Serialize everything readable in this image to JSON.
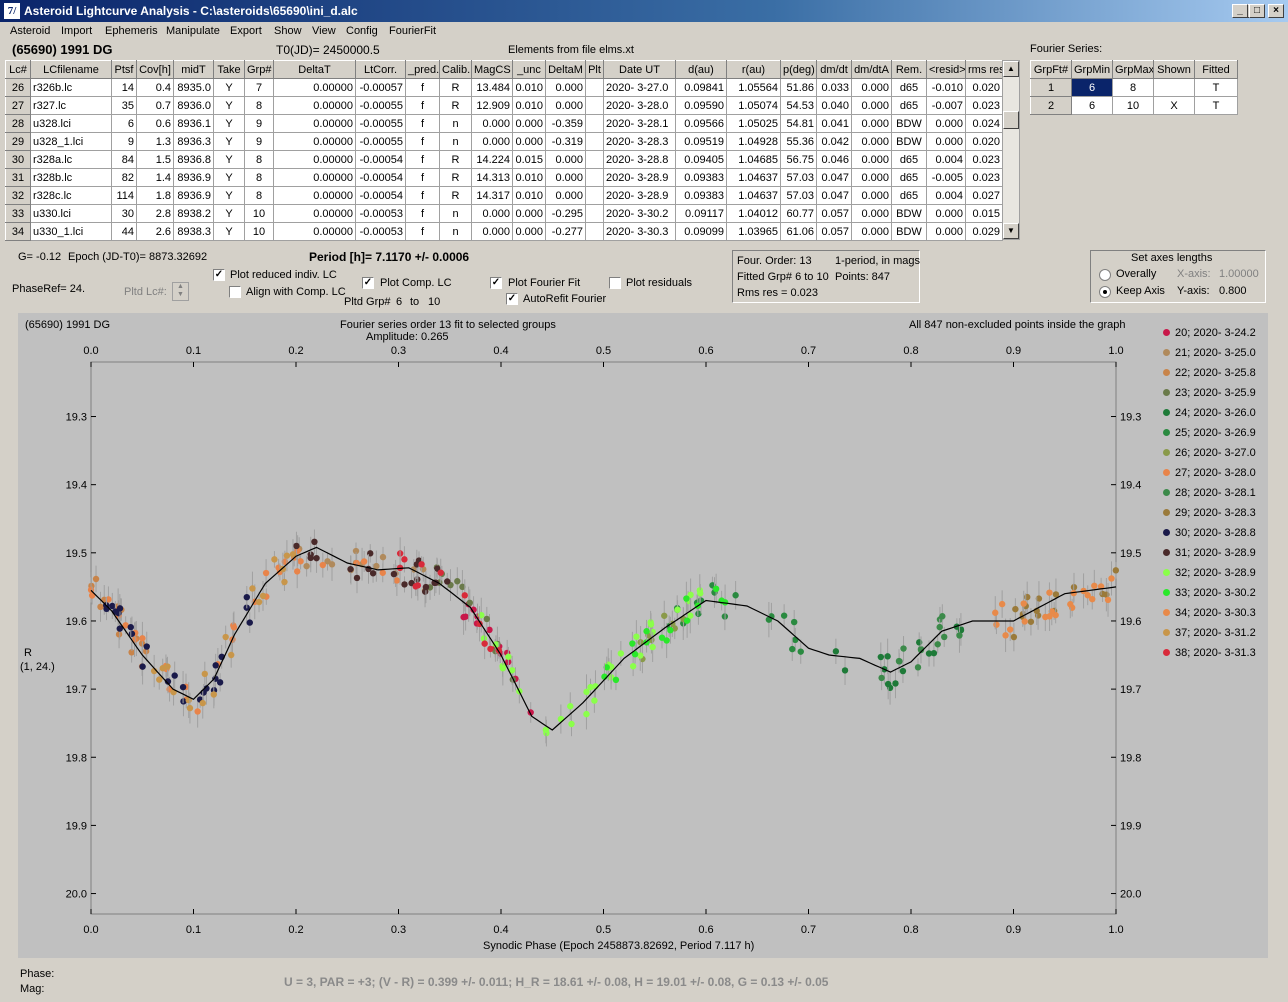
{
  "window": {
    "title": "Asteroid Lightcurve Analysis - C:\\asteroids\\65690\\ini_d.alc",
    "icon": "7/"
  },
  "menu": [
    "Asteroid",
    "Import",
    "Ephemeris",
    "Manipulate",
    "Export",
    "Show",
    "View",
    "Config",
    "FourierFit"
  ],
  "header": {
    "object": "(65690) 1991 DG",
    "t0": "T0(JD)= 2450000.5",
    "elements": "Elements from file elms.xt"
  },
  "lc_table": {
    "columns": [
      "Lc#",
      "LCfilename",
      "Ptsf",
      "Cov[h]",
      "midT",
      "Take",
      "Grp#",
      "DeltaT",
      "LtCorr.",
      "_pred.",
      "Calib.",
      "MagCS",
      "_unc",
      "DeltaM",
      "Plt",
      "Date UT",
      "d(au)",
      "r(au)",
      "p(deg)",
      "dm/dt",
      "dm/dtA",
      "Rem.",
      "<resid>",
      "rms res"
    ],
    "rows": [
      [
        "26",
        "r326b.lc",
        "14",
        "0.4",
        "8935.0",
        "Y",
        "7",
        "0.00000",
        "-0.00057",
        "f",
        "R",
        "13.484",
        "0.010",
        "0.000",
        "",
        "2020- 3-27.0",
        "0.09841",
        "1.05564",
        "51.86",
        "0.033",
        "0.000",
        "d65",
        "-0.010",
        "0.020"
      ],
      [
        "27",
        "r327.lc",
        "35",
        "0.7",
        "8936.0",
        "Y",
        "8",
        "0.00000",
        "-0.00055",
        "f",
        "R",
        "12.909",
        "0.010",
        "0.000",
        "",
        "2020- 3-28.0",
        "0.09590",
        "1.05074",
        "54.53",
        "0.040",
        "0.000",
        "d65",
        "-0.007",
        "0.023"
      ],
      [
        "28",
        "u328.lci",
        "6",
        "0.6",
        "8936.1",
        "Y",
        "9",
        "0.00000",
        "-0.00055",
        "f",
        "n",
        "0.000",
        "0.000",
        "-0.359",
        "",
        "2020- 3-28.1",
        "0.09566",
        "1.05025",
        "54.81",
        "0.041",
        "0.000",
        "BDW",
        "0.000",
        "0.024"
      ],
      [
        "29",
        "u328_1.lci",
        "9",
        "1.3",
        "8936.3",
        "Y",
        "9",
        "0.00000",
        "-0.00055",
        "f",
        "n",
        "0.000",
        "0.000",
        "-0.319",
        "",
        "2020- 3-28.3",
        "0.09519",
        "1.04928",
        "55.36",
        "0.042",
        "0.000",
        "BDW",
        "0.000",
        "0.020"
      ],
      [
        "30",
        "r328a.lc",
        "84",
        "1.5",
        "8936.8",
        "Y",
        "8",
        "0.00000",
        "-0.00054",
        "f",
        "R",
        "14.224",
        "0.015",
        "0.000",
        "",
        "2020- 3-28.8",
        "0.09405",
        "1.04685",
        "56.75",
        "0.046",
        "0.000",
        "d65",
        "0.004",
        "0.023"
      ],
      [
        "31",
        "r328b.lc",
        "82",
        "1.4",
        "8936.9",
        "Y",
        "8",
        "0.00000",
        "-0.00054",
        "f",
        "R",
        "14.313",
        "0.010",
        "0.000",
        "",
        "2020- 3-28.9",
        "0.09383",
        "1.04637",
        "57.03",
        "0.047",
        "0.000",
        "d65",
        "-0.005",
        "0.023"
      ],
      [
        "32",
        "r328c.lc",
        "114",
        "1.8",
        "8936.9",
        "Y",
        "8",
        "0.00000",
        "-0.00054",
        "f",
        "R",
        "14.317",
        "0.010",
        "0.000",
        "",
        "2020- 3-28.9",
        "0.09383",
        "1.04637",
        "57.03",
        "0.047",
        "0.000",
        "d65",
        "0.004",
        "0.027"
      ],
      [
        "33",
        "u330.lci",
        "30",
        "2.8",
        "8938.2",
        "Y",
        "10",
        "0.00000",
        "-0.00053",
        "f",
        "n",
        "0.000",
        "0.000",
        "-0.295",
        "",
        "2020- 3-30.2",
        "0.09117",
        "1.04012",
        "60.77",
        "0.057",
        "0.000",
        "BDW",
        "0.000",
        "0.015"
      ],
      [
        "34",
        "u330_1.lci",
        "44",
        "2.6",
        "8938.3",
        "Y",
        "10",
        "0.00000",
        "-0.00053",
        "f",
        "n",
        "0.000",
        "0.000",
        "-0.277",
        "",
        "2020- 3-30.3",
        "0.09099",
        "1.03965",
        "61.06",
        "0.057",
        "0.000",
        "BDW",
        "0.000",
        "0.029"
      ]
    ]
  },
  "fourier_series": {
    "title": "Fourier Series:",
    "columns": [
      "GrpFt#",
      "GrpMin",
      "GrpMax",
      "Shown",
      "Fitted"
    ],
    "rows": [
      [
        "1",
        "6",
        "8",
        "",
        "T"
      ],
      [
        "2",
        "6",
        "10",
        "X",
        "T"
      ]
    ]
  },
  "params": {
    "g": "G= -0.12",
    "epoch": "Epoch (JD-T0)= 8873.32692",
    "period": "Period [h]= 7.1170 +/- 0.0006",
    "phaseref": "PhaseRef= 24.",
    "pltd_lc": "Pltd Lc#:",
    "pltd_grp": "Pltd Grp#",
    "grp_from": "6",
    "grp_to_lbl": "to",
    "grp_to": "10"
  },
  "options": {
    "plot_reduced": "Plot reduced indiv. LC",
    "align_comp": "Align with Comp. LC",
    "plot_comp": "Plot Comp. LC",
    "plot_fourier": "Plot Fourier Fit",
    "autorefit": "AutoRefit Fourier",
    "plot_residuals": "Plot residuals"
  },
  "fit_info": {
    "order": "Four. Order: 13",
    "mode": "1-period, in mags",
    "fitted": "Fitted Grp# 6 to 10",
    "points": "Points: 847",
    "rms": "Rms res    = 0.023"
  },
  "axes_box": {
    "title": "Set axes lengths",
    "overally": "Overally",
    "keep": "Keep Axis",
    "xaxis_lbl": "X-axis:",
    "xaxis_val": "1.00000",
    "yaxis_lbl": "Y-axis:",
    "yaxis_val": "0.800"
  },
  "plot": {
    "object": "(65690) 1991 DG",
    "title": "Fourier series order 13 fit to selected groups",
    "amplitude": "Amplitude: 0.265",
    "note": "All 847 non-excluded points inside the graph",
    "ylabel1": "R",
    "ylabel2": "(1, 24.)",
    "xlabel": "Synodic Phase (Epoch 2458873.82692, Period 7.117 h)"
  },
  "chart_data": {
    "type": "scatter",
    "x_ticks": [
      "0.0",
      "0.1",
      "0.2",
      "0.3",
      "0.4",
      "0.5",
      "0.6",
      "0.7",
      "0.8",
      "0.9",
      "1.0"
    ],
    "y_ticks": [
      "19.3",
      "19.4",
      "19.5",
      "19.6",
      "19.7",
      "19.8",
      "19.9",
      "20.0"
    ],
    "xlim": [
      0,
      1
    ],
    "ylim": [
      19.22,
      20.03
    ],
    "y_inverted": true,
    "fit_curve": [
      [
        0,
        19.555
      ],
      [
        0.02,
        19.585
      ],
      [
        0.05,
        19.65
      ],
      [
        0.08,
        19.7
      ],
      [
        0.1,
        19.715
      ],
      [
        0.12,
        19.685
      ],
      [
        0.14,
        19.62
      ],
      [
        0.17,
        19.545
      ],
      [
        0.2,
        19.505
      ],
      [
        0.22,
        19.492
      ],
      [
        0.25,
        19.515
      ],
      [
        0.28,
        19.525
      ],
      [
        0.31,
        19.522
      ],
      [
        0.34,
        19.545
      ],
      [
        0.37,
        19.58
      ],
      [
        0.4,
        19.65
      ],
      [
        0.43,
        19.74
      ],
      [
        0.45,
        19.76
      ],
      [
        0.48,
        19.72
      ],
      [
        0.52,
        19.655
      ],
      [
        0.56,
        19.61
      ],
      [
        0.6,
        19.57
      ],
      [
        0.64,
        19.578
      ],
      [
        0.67,
        19.6
      ],
      [
        0.7,
        19.64
      ],
      [
        0.72,
        19.65
      ],
      [
        0.75,
        19.655
      ],
      [
        0.78,
        19.675
      ],
      [
        0.8,
        19.66
      ],
      [
        0.83,
        19.615
      ],
      [
        0.86,
        19.6
      ],
      [
        0.9,
        19.6
      ],
      [
        0.95,
        19.56
      ],
      [
        1,
        19.55
      ]
    ],
    "series": [
      {
        "name": "20; 2020- 3-24.2",
        "color": "#c8184a",
        "range": [
          0.36,
          0.43
        ],
        "n": 14
      },
      {
        "name": "21; 2020- 3-25.0",
        "color": "#b08a5c",
        "range": [
          0.2,
          0.33
        ],
        "n": 14
      },
      {
        "name": "22; 2020- 3-25.8",
        "color": "#c8844a",
        "range": [
          0.0,
          0.06
        ],
        "n": 14
      },
      {
        "name": "23; 2020- 3-25.9",
        "color": "#6a7a4a",
        "range": [
          0.33,
          0.42
        ],
        "n": 12
      },
      {
        "name": "24; 2020- 3-26.0",
        "color": "#1e7a38",
        "range": [
          0.72,
          0.85
        ],
        "n": 16
      },
      {
        "name": "25; 2020- 3-26.9",
        "color": "#2a8a40",
        "range": [
          0.56,
          0.7
        ],
        "n": 18
      },
      {
        "name": "26; 2020- 3-27.0",
        "color": "#8a9a4a",
        "range": [
          0.53,
          0.58
        ],
        "n": 8
      },
      {
        "name": "27; 2020- 3-28.0",
        "color": "#e8844a",
        "range": [
          0.0,
          0.3
        ],
        "n": 34
      },
      {
        "name": "28; 2020- 3-28.1",
        "color": "#3c8a4a",
        "range": [
          0.77,
          0.85
        ],
        "n": 12
      },
      {
        "name": "29; 2020- 3-28.3",
        "color": "#9a7a3a",
        "range": [
          0.9,
          1.0
        ],
        "n": 16
      },
      {
        "name": "30; 2020- 3-28.8",
        "color": "#1a1a4a",
        "range": [
          0.0,
          0.16
        ],
        "n": 26
      },
      {
        "name": "31; 2020- 3-28.9",
        "color": "#4a2a2a",
        "range": [
          0.2,
          0.35
        ],
        "n": 22
      },
      {
        "name": "32; 2020- 3-28.9",
        "color": "#8aff4a",
        "range": [
          0.38,
          0.6
        ],
        "n": 36
      },
      {
        "name": "33; 2020- 3-30.2",
        "color": "#2ae82a",
        "range": [
          0.5,
          0.62
        ],
        "n": 16
      },
      {
        "name": "34; 2020- 3-30.3",
        "color": "#e88a4a",
        "range": [
          0.88,
          1.0
        ],
        "n": 22
      },
      {
        "name": "37; 2020- 3-31.2",
        "color": "#c8964a",
        "range": [
          0.06,
          0.2
        ],
        "n": 20
      },
      {
        "name": "38; 2020- 3-31.3",
        "color": "#d82a3a",
        "range": [
          0.29,
          0.4
        ],
        "n": 12
      }
    ]
  },
  "footer": {
    "phase": "Phase:",
    "mag": "Mag:",
    "summary": "U = 3,  PAR = +3;  (V - R) = 0.399 +/- 0.011;  H_R = 18.61 +/- 0.08,  H = 19.01 +/- 0.08,  G = 0.13 +/- 0.05"
  }
}
